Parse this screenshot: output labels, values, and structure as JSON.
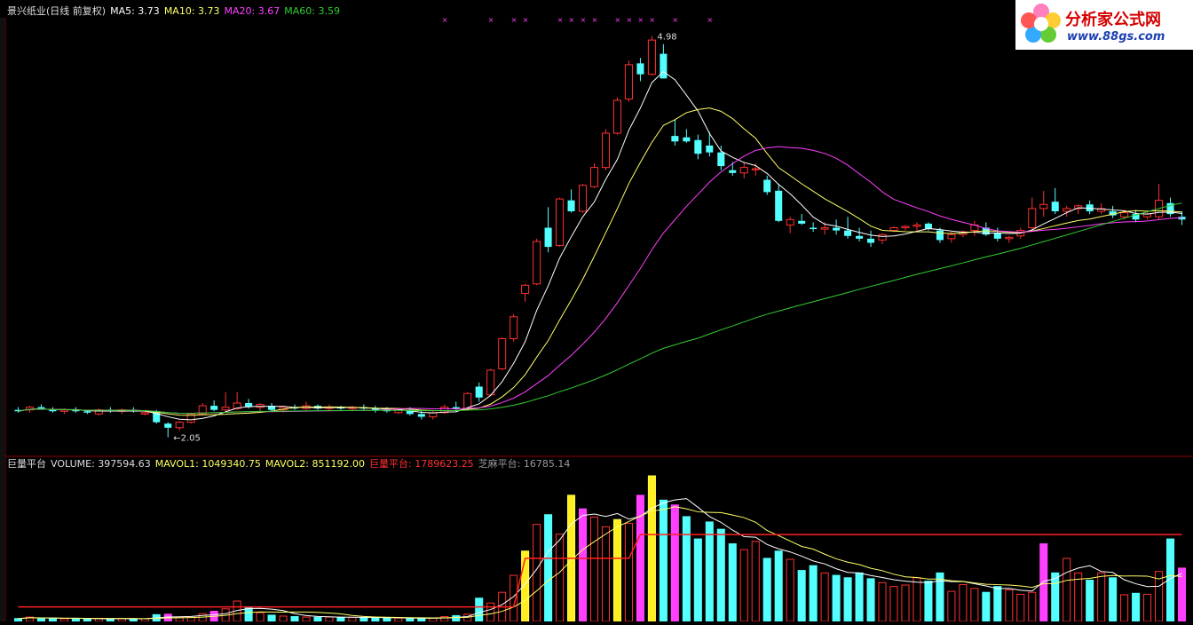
{
  "header": {
    "stock_name": "景兴纸业(日线 前复权)",
    "ma5": "MA5: 3.73",
    "ma10": "MA10: 3.73",
    "ma20": "MA20: 3.67",
    "ma60": "MA60: 3.59"
  },
  "volume_header": {
    "name": "巨量平台",
    "volume": "VOLUME: 397594.63",
    "mavol1": "MAVOL1: 1049340.75",
    "mavol2": "MAVOL2: 851192.00",
    "giant": "巨量平台: 1789623.25",
    "sesame": "芝麻平台: 16785.14"
  },
  "logo": {
    "title": "分析家公式网",
    "url": "www.88gs.com"
  },
  "colors": {
    "up": "#ff3030",
    "down": "#54ffff",
    "ma5": "#ffffff",
    "ma10": "#ffff66",
    "ma20": "#ff40ff",
    "ma60": "#33cc33",
    "vol_line": "#ff2020",
    "mark": "#ff40ff"
  },
  "chart_data": [
    {
      "type": "candlestick",
      "title": "景兴纸业(日线 前复权)",
      "ylim": [
        1.95,
        5.1
      ],
      "annotations": [
        {
          "text": "4.98",
          "index": 55,
          "value": 4.98
        },
        {
          "text": "2.05",
          "index": 13,
          "value": 2.05
        }
      ],
      "candles": [
        [
          2.25,
          2.27,
          2.23,
          2.24
        ],
        [
          2.25,
          2.28,
          2.23,
          2.27
        ],
        [
          2.27,
          2.29,
          2.25,
          2.26
        ],
        [
          2.25,
          2.27,
          2.23,
          2.24
        ],
        [
          2.24,
          2.26,
          2.22,
          2.25
        ],
        [
          2.25,
          2.27,
          2.23,
          2.24
        ],
        [
          2.24,
          2.25,
          2.22,
          2.23
        ],
        [
          2.22,
          2.26,
          2.21,
          2.25
        ],
        [
          2.25,
          2.27,
          2.23,
          2.24
        ],
        [
          2.24,
          2.26,
          2.22,
          2.25
        ],
        [
          2.25,
          2.27,
          2.23,
          2.24
        ],
        [
          2.22,
          2.25,
          2.21,
          2.23
        ],
        [
          2.24,
          2.25,
          2.15,
          2.16
        ],
        [
          2.15,
          2.16,
          2.05,
          2.12
        ],
        [
          2.12,
          2.17,
          2.1,
          2.16
        ],
        [
          2.16,
          2.23,
          2.15,
          2.22
        ],
        [
          2.22,
          2.3,
          2.21,
          2.28
        ],
        [
          2.28,
          2.32,
          2.24,
          2.25
        ],
        [
          2.25,
          2.38,
          2.24,
          2.27
        ],
        [
          2.26,
          2.38,
          2.25,
          2.3
        ],
        [
          2.3,
          2.33,
          2.26,
          2.27
        ],
        [
          2.27,
          2.3,
          2.24,
          2.29
        ],
        [
          2.28,
          2.3,
          2.24,
          2.25
        ],
        [
          2.25,
          2.28,
          2.23,
          2.27
        ],
        [
          2.27,
          2.29,
          2.25,
          2.26
        ],
        [
          2.26,
          2.31,
          2.25,
          2.28
        ],
        [
          2.28,
          2.29,
          2.25,
          2.26
        ],
        [
          2.26,
          2.29,
          2.24,
          2.27
        ],
        [
          2.27,
          2.28,
          2.25,
          2.26
        ],
        [
          2.26,
          2.28,
          2.24,
          2.27
        ],
        [
          2.27,
          2.29,
          2.25,
          2.26
        ],
        [
          2.26,
          2.28,
          2.23,
          2.25
        ],
        [
          2.25,
          2.27,
          2.23,
          2.24
        ],
        [
          2.23,
          2.26,
          2.22,
          2.25
        ],
        [
          2.25,
          2.27,
          2.21,
          2.22
        ],
        [
          2.22,
          2.25,
          2.18,
          2.2
        ],
        [
          2.2,
          2.24,
          2.18,
          2.23
        ],
        [
          2.23,
          2.29,
          2.22,
          2.27
        ],
        [
          2.27,
          2.31,
          2.24,
          2.26
        ],
        [
          2.26,
          2.38,
          2.25,
          2.37
        ],
        [
          2.42,
          2.45,
          2.31,
          2.34
        ],
        [
          2.36,
          2.55,
          2.35,
          2.54
        ],
        [
          2.55,
          2.78,
          2.54,
          2.77
        ],
        [
          2.77,
          2.95,
          2.75,
          2.93
        ],
        [
          3.1,
          3.17,
          3.04,
          3.16
        ],
        [
          3.17,
          3.5,
          3.16,
          3.48
        ],
        [
          3.58,
          3.73,
          3.4,
          3.44
        ],
        [
          3.45,
          3.8,
          3.44,
          3.79
        ],
        [
          3.78,
          3.86,
          3.69,
          3.7
        ],
        [
          3.7,
          3.9,
          3.69,
          3.89
        ],
        [
          3.88,
          4.05,
          3.87,
          4.02
        ],
        [
          4.02,
          4.3,
          4.0,
          4.27
        ],
        [
          4.27,
          4.53,
          4.26,
          4.51
        ],
        [
          4.52,
          4.8,
          4.5,
          4.77
        ],
        [
          4.78,
          4.82,
          4.65,
          4.7
        ],
        [
          4.7,
          4.98,
          4.69,
          4.95
        ],
        [
          4.85,
          4.92,
          4.67,
          4.67
        ],
        [
          4.25,
          4.37,
          4.18,
          4.21
        ],
        [
          4.24,
          4.3,
          4.2,
          4.21
        ],
        [
          4.22,
          4.26,
          4.08,
          4.12
        ],
        [
          4.18,
          4.28,
          4.1,
          4.13
        ],
        [
          4.13,
          4.18,
          4.0,
          4.03
        ],
        [
          4.0,
          4.06,
          3.96,
          3.98
        ],
        [
          3.98,
          4.06,
          3.94,
          4.02
        ],
        [
          4.01,
          4.05,
          3.96,
          4.01
        ],
        [
          3.93,
          3.96,
          3.82,
          3.84
        ],
        [
          3.85,
          3.9,
          3.62,
          3.63
        ],
        [
          3.6,
          3.66,
          3.54,
          3.64
        ],
        [
          3.63,
          3.68,
          3.6,
          3.61
        ],
        [
          3.58,
          3.62,
          3.55,
          3.57
        ],
        [
          3.57,
          3.62,
          3.53,
          3.58
        ],
        [
          3.58,
          3.64,
          3.53,
          3.56
        ],
        [
          3.56,
          3.66,
          3.5,
          3.52
        ],
        [
          3.52,
          3.58,
          3.48,
          3.5
        ],
        [
          3.5,
          3.56,
          3.44,
          3.47
        ],
        [
          3.49,
          3.54,
          3.46,
          3.53
        ],
        [
          3.56,
          3.59,
          3.55,
          3.58
        ],
        [
          3.58,
          3.6,
          3.56,
          3.59
        ],
        [
          3.59,
          3.62,
          3.56,
          3.6
        ],
        [
          3.61,
          3.62,
          3.56,
          3.57
        ],
        [
          3.56,
          3.58,
          3.47,
          3.49
        ],
        [
          3.5,
          3.55,
          3.47,
          3.53
        ],
        [
          3.53,
          3.56,
          3.51,
          3.55
        ],
        [
          3.56,
          3.63,
          3.52,
          3.6
        ],
        [
          3.58,
          3.62,
          3.52,
          3.53
        ],
        [
          3.54,
          3.58,
          3.48,
          3.5
        ],
        [
          3.5,
          3.52,
          3.47,
          3.51
        ],
        [
          3.52,
          3.58,
          3.5,
          3.56
        ],
        [
          3.58,
          3.8,
          3.55,
          3.72
        ],
        [
          3.72,
          3.85,
          3.66,
          3.75
        ],
        [
          3.77,
          3.87,
          3.68,
          3.7
        ],
        [
          3.7,
          3.74,
          3.66,
          3.72
        ],
        [
          3.72,
          3.75,
          3.68,
          3.74
        ],
        [
          3.75,
          3.78,
          3.68,
          3.7
        ],
        [
          3.7,
          3.76,
          3.68,
          3.72
        ],
        [
          3.7,
          3.74,
          3.65,
          3.67
        ],
        [
          3.66,
          3.7,
          3.64,
          3.69
        ],
        [
          3.68,
          3.71,
          3.62,
          3.64
        ],
        [
          3.66,
          3.7,
          3.64,
          3.68
        ],
        [
          3.66,
          3.9,
          3.64,
          3.78
        ],
        [
          3.76,
          3.8,
          3.66,
          3.68
        ],
        [
          3.66,
          3.7,
          3.6,
          3.64
        ]
      ]
    },
    {
      "type": "bar",
      "title": "巨量平台",
      "ylim": [
        0,
        3000000
      ],
      "series_names": [
        "VOLUME",
        "MAVOL1",
        "MAVOL2",
        "巨量平台"
      ],
      "volume": [
        60,
        90,
        70,
        60,
        55,
        60,
        50,
        60,
        55,
        60,
        55,
        55,
        140,
        150,
        80,
        85,
        160,
        210,
        260,
        420,
        280,
        180,
        130,
        110,
        100,
        90,
        85,
        90,
        80,
        85,
        80,
        75,
        70,
        70,
        60,
        60,
        70,
        100,
        120,
        150,
        480,
        380,
        600,
        950,
        1450,
        2000,
        2200,
        1800,
        2600,
        2320,
        2150,
        1950,
        2100,
        2020,
        2600,
        3000,
        2500,
        2400,
        2160,
        1700,
        2050,
        1900,
        1600,
        1480,
        1650,
        1300,
        1450,
        1280,
        1050,
        1150,
        1000,
        950,
        900,
        1000,
        880,
        800,
        720,
        750,
        900,
        830,
        1000,
        620,
        760,
        680,
        600,
        720,
        650,
        560,
        600,
        1600,
        1000,
        1300,
        1000,
        850,
        1000,
        900,
        550,
        580,
        560,
        1030,
        1700,
        1100
      ]
    }
  ]
}
